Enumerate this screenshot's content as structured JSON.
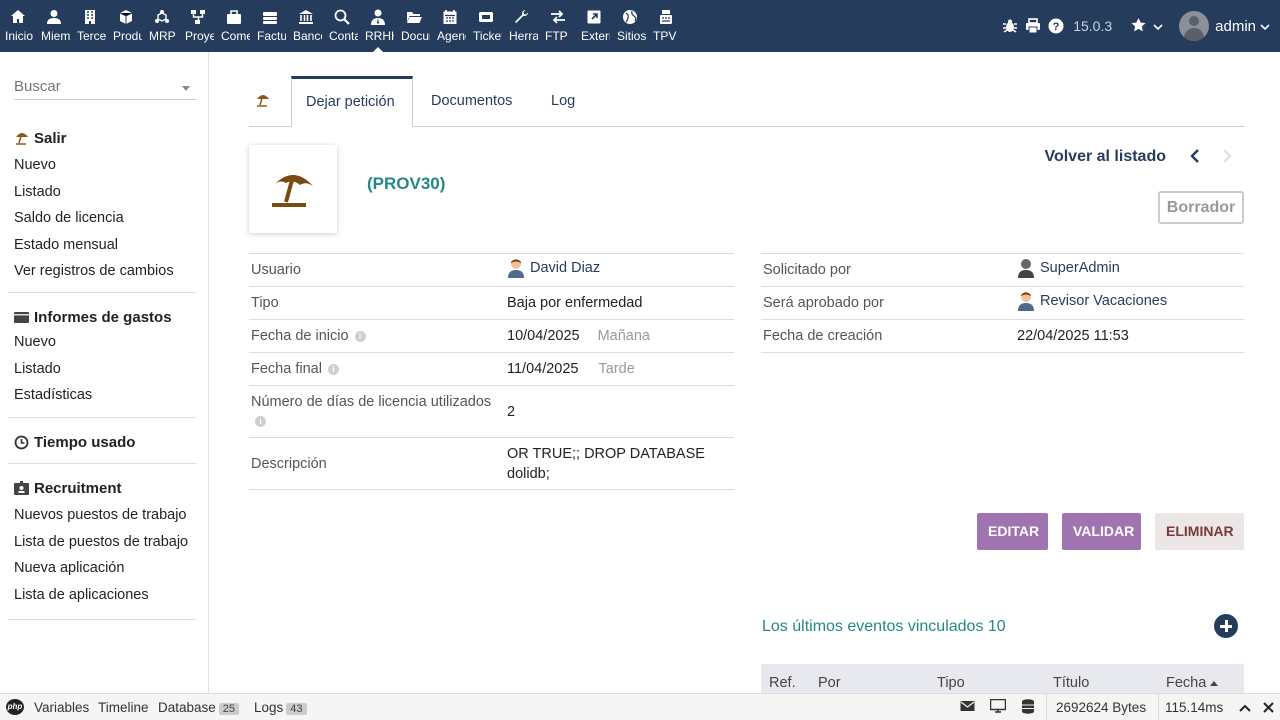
{
  "topnav": {
    "items": [
      {
        "label": "Inicio",
        "icon": "home-icon"
      },
      {
        "label": "Miembros",
        "icon": "member-icon"
      },
      {
        "label": "Terceros",
        "icon": "building-icon"
      },
      {
        "label": "Productos",
        "icon": "cube-icon"
      },
      {
        "label": "MRP",
        "icon": "cubes-icon"
      },
      {
        "label": "Proyectos",
        "icon": "sitemap-icon"
      },
      {
        "label": "Comercial",
        "icon": "suitcase-icon"
      },
      {
        "label": "Facturación",
        "icon": "money-stack-icon"
      },
      {
        "label": "Bancos",
        "icon": "bank-icon"
      },
      {
        "label": "Contabilidad",
        "icon": "search-dollar-icon"
      },
      {
        "label": "RRHH",
        "icon": "person-tie-icon"
      },
      {
        "label": "Documentos",
        "icon": "folder-open-icon"
      },
      {
        "label": "Agenda",
        "icon": "calendar-icon"
      },
      {
        "label": "Tickets",
        "icon": "ticket-icon"
      },
      {
        "label": "Herramientas",
        "icon": "wrench-icon"
      },
      {
        "label": "FTP",
        "icon": "exchange-icon"
      },
      {
        "label": "Externo",
        "icon": "external-link-icon"
      },
      {
        "label": "Sitios",
        "icon": "globe-icon"
      },
      {
        "label": "TPV",
        "icon": "cash-register-icon"
      }
    ],
    "active_index": 10
  },
  "topright": {
    "version": "15.0.3",
    "username": "admin"
  },
  "sidebar": {
    "search_placeholder": "Buscar",
    "sections": [
      {
        "title": "Salir",
        "icon": "beach-umbrella-icon",
        "links": [
          "Nuevo",
          "Listado",
          "Saldo de licencia",
          "Estado mensual",
          "Ver registros de cambios"
        ]
      },
      {
        "title": "Informes de gastos",
        "icon": "wallet-icon",
        "links": [
          "Nuevo",
          "Listado",
          "Estadísticas"
        ]
      },
      {
        "title": "Tiempo usado",
        "icon": "clock-icon",
        "links": []
      },
      {
        "title": "Recruitment",
        "icon": "id-badge-icon",
        "links": [
          "Nuevos puestos de trabajo",
          "Lista de puestos de trabajo",
          "Nueva aplicación",
          "Lista de aplicaciones"
        ]
      }
    ]
  },
  "tabs": [
    "Dejar petición",
    "Documentos",
    "Log"
  ],
  "record": {
    "ref": "(PROV30)",
    "back_label": "Volver al listado",
    "status": "Borrador"
  },
  "left_fields": [
    {
      "label": "Usuario",
      "value": "David Diaz",
      "user": true
    },
    {
      "label": "Tipo",
      "value": "Baja por enfermedad"
    },
    {
      "label": "Fecha de inicio",
      "value": "10/04/2025",
      "extra": "Mañana",
      "info": true
    },
    {
      "label": "Fecha final",
      "value": "11/04/2025",
      "extra": "Tarde",
      "info": true
    },
    {
      "label": "Número de días de licencia utilizados",
      "value": "2",
      "info": true
    },
    {
      "label": "Descripción",
      "value": "OR TRUE;; DROP DATABASE dolidb;"
    }
  ],
  "right_fields": [
    {
      "label": "Solicitado por",
      "value": "SuperAdmin",
      "user": true,
      "icon": "user-dark-icon"
    },
    {
      "label": "Será aprobado por",
      "value": "Revisor Vacaciones",
      "user": true,
      "icon": "user-icon"
    },
    {
      "label": "Fecha de creación",
      "value": "22/04/2025 11:53"
    }
  ],
  "actions": {
    "edit": "EDITAR",
    "validate": "VALIDAR",
    "delete": "ELIMINAR"
  },
  "events": {
    "title": "Los últimos eventos vinculados 10",
    "columns": [
      "Ref.",
      "Por",
      "Tipo",
      "Título",
      "Fecha"
    ]
  },
  "debugbar": {
    "variables": "Variables",
    "timeline": "Timeline",
    "database": "Database",
    "database_count": "25",
    "logs": "Logs",
    "logs_count": "43",
    "bytes": "2692624 Bytes",
    "time": "115.14ms"
  },
  "colors": {
    "topbar": "#263c5c",
    "accent": "#258884",
    "button": "#a074b0"
  }
}
